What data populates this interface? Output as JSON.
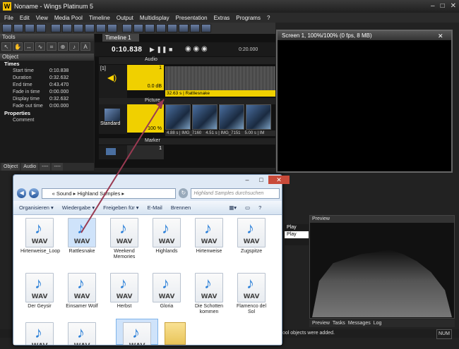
{
  "app": {
    "title": "Noname - Wings Platinum 5",
    "menu": [
      "File",
      "Edit",
      "View",
      "Media Pool",
      "Timeline",
      "Output",
      "Multidisplay",
      "Presentation",
      "Extras",
      "Programs",
      "?"
    ]
  },
  "tools": {
    "header": "Tools"
  },
  "object_panel": {
    "header": "Object",
    "times_label": "Times",
    "times": [
      {
        "k": "Start time",
        "v": "0:10.838"
      },
      {
        "k": "Duration",
        "v": "0:32.632"
      },
      {
        "k": "End time",
        "v": "0:43.470"
      },
      {
        "k": "Fade in time",
        "v": "0:00.000"
      },
      {
        "k": "Display time",
        "v": "0:32.632"
      },
      {
        "k": "Fade out time",
        "v": "0:00.000"
      }
    ],
    "properties_label": "Properties",
    "comment_label": "Comment",
    "tabs": [
      "Object",
      "Audio",
      "----",
      "----"
    ]
  },
  "timeline": {
    "tab": "Timeline 1",
    "timecode": "0:10.838",
    "marker_time": "0:20.000",
    "audio_label": "Audio",
    "audio_track_num": "1",
    "audio_track_bracket": "[1]",
    "audio_db": "0.0 dB",
    "picture_label": "Picture",
    "picture_track_num": "1",
    "standard_label": "Standard",
    "picture_pct": "100 %",
    "marker_label": "Marker",
    "marker_track_num": "1",
    "clip_caption": "32.63 s | Rattlesnake",
    "pic_captions": [
      "4.88 s | IMG_7160",
      "4.51 s | IMG_7151",
      "5.00 s | IM"
    ]
  },
  "screen_window": {
    "title": "Screen 1, 100%/100% (0 fps, 8 MB)"
  },
  "play_mini": [
    "Play",
    "Play"
  ],
  "preview": {
    "header": "Preview",
    "tabs": [
      "Preview",
      "Tasks",
      "Messages",
      "Log"
    ]
  },
  "status": {
    "message": "ool objects were added.",
    "num": "NUM"
  },
  "explorer": {
    "path_sep": "«",
    "path": [
      "Sound",
      "Highland Samples"
    ],
    "search_placeholder": "Highland Samples durchsuchen",
    "commands": [
      "Organisieren ▾",
      "Wiedergabe ▾",
      "Freigeben für ▾",
      "E-Mail",
      "Brennen"
    ],
    "files_row1": [
      "Hirtenweise_Loop",
      "Rattlesnake",
      "Weekend Memories",
      "Highlands",
      "Hirtenweise",
      "Zugspitze"
    ],
    "files_row2": [
      "Der Geysir",
      "Einsamer Wolf",
      "Herbst",
      "Gloria",
      "Die Schotten kommen",
      "Flamenco del Sol"
    ],
    "wav_label": "WAV"
  }
}
